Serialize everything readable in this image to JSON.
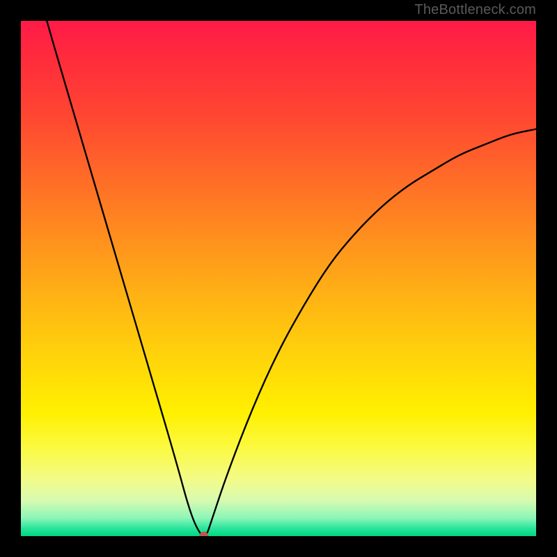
{
  "attribution": "TheBottleneck.com",
  "chart_data": {
    "type": "line",
    "title": "",
    "xlabel": "",
    "ylabel": "",
    "xlim": [
      0,
      100
    ],
    "ylim": [
      0,
      100
    ],
    "grid": false,
    "legend": false,
    "background": "rainbow-gradient-vertical",
    "series": [
      {
        "name": "bottleneck-curve",
        "x": [
          0,
          5,
          10,
          15,
          20,
          25,
          30,
          33,
          35,
          36,
          37,
          40,
          45,
          50,
          55,
          60,
          65,
          70,
          75,
          80,
          85,
          90,
          95,
          100
        ],
        "values": [
          118,
          100,
          83,
          66,
          49,
          32,
          15,
          4,
          0,
          0,
          3,
          12,
          25,
          36,
          45,
          53,
          59,
          64,
          68,
          71,
          74,
          76,
          78,
          79
        ]
      }
    ],
    "annotations": [
      {
        "type": "point",
        "name": "minimum-marker",
        "x": 35.5,
        "y": 0,
        "color": "#B55A4A"
      }
    ],
    "colors": {
      "curve": "#000000",
      "frame": "#000000",
      "gradient_top": "#FF1A47",
      "gradient_bottom": "#00D880"
    }
  }
}
